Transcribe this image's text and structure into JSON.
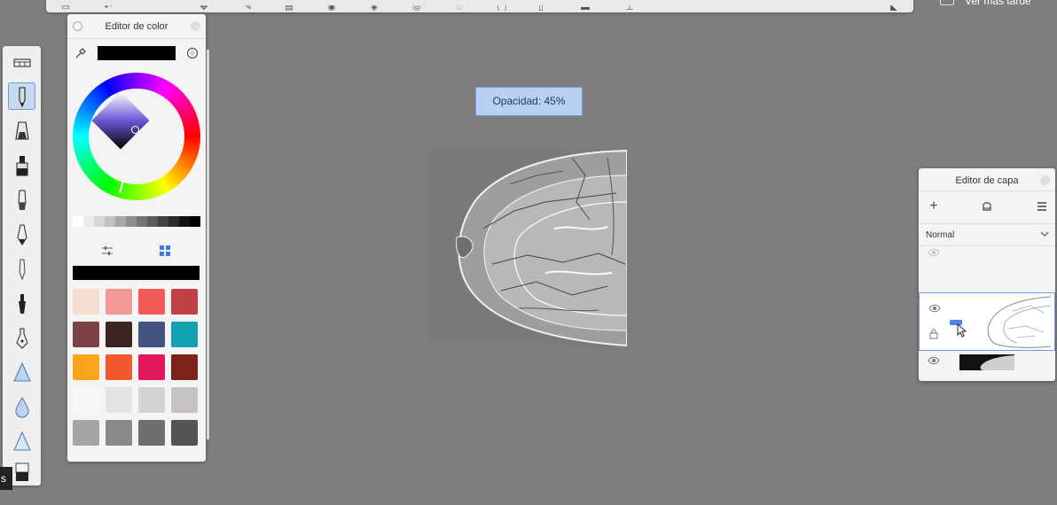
{
  "top_bar": {
    "right_text": "Ver más tarde"
  },
  "tools": {
    "items": [
      {
        "name": "brush-settings",
        "selected": false
      },
      {
        "name": "pencil",
        "selected": true
      },
      {
        "name": "marker",
        "selected": false
      },
      {
        "name": "airbrush",
        "selected": false
      },
      {
        "name": "paintbrush",
        "selected": false
      },
      {
        "name": "pen",
        "selected": false
      },
      {
        "name": "fineliner",
        "selected": false
      },
      {
        "name": "ink-pen",
        "selected": false
      },
      {
        "name": "fountain-pen",
        "selected": false
      },
      {
        "name": "smudge",
        "selected": false
      },
      {
        "name": "blur",
        "selected": false
      },
      {
        "name": "sharpen",
        "selected": false
      },
      {
        "name": "eraser",
        "selected": false
      }
    ]
  },
  "color_editor": {
    "title": "Editor de color",
    "current_color": "#000000",
    "grays": [
      "#ffffff",
      "#ececec",
      "#d6d6d6",
      "#c0c0c0",
      "#a8a8a8",
      "#8e8e8e",
      "#747474",
      "#5b5b5b",
      "#424242",
      "#2a2a2a",
      "#111111",
      "#000000"
    ],
    "swatches": [
      "#f4ddd0",
      "#f39895",
      "#f05a59",
      "#c04043",
      "#7b4345",
      "#3a2522",
      "#445482",
      "#13a2b3",
      "#fca41b",
      "#f1582b",
      "#e2185a",
      "#7d2318",
      "#f7f7f7",
      "#e4e1e3",
      "#d6d3d7",
      "#c6c2c6",
      "#a6a4a6",
      "#8a888b",
      "#6e6d70",
      "#555356"
    ]
  },
  "opacity_tooltip": {
    "text": "Opacidad: 45%",
    "value_percent": 45
  },
  "layer_editor": {
    "title": "Editor de capa",
    "blend_mode": "Normal"
  },
  "bottom_label": "s"
}
